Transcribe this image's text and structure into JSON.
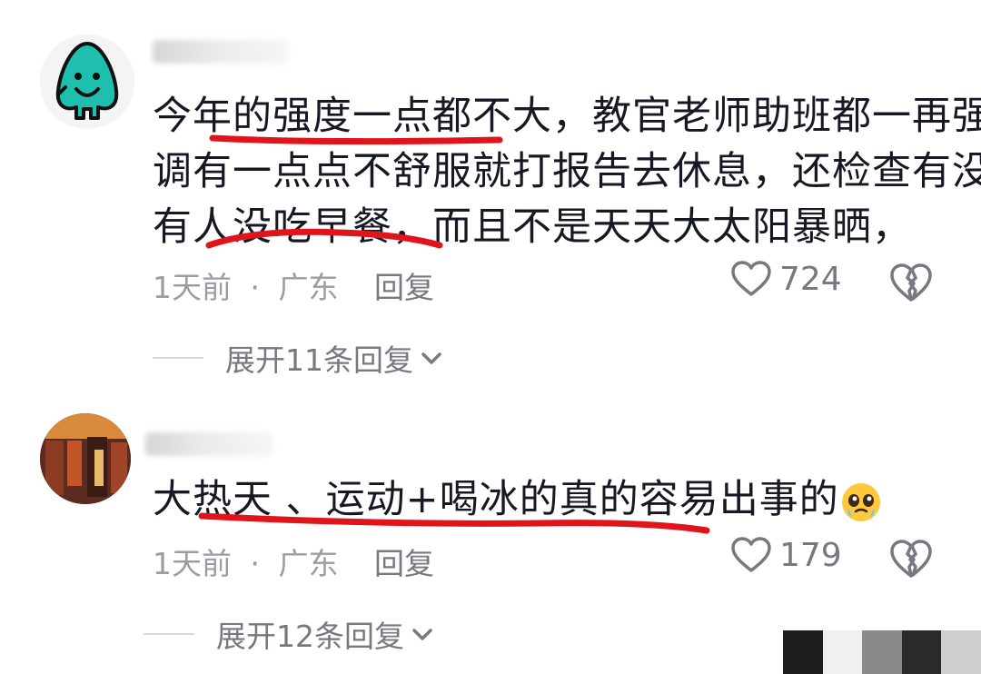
{
  "comments": [
    {
      "text_lines": [
        "今年的强度一点都不大，教官老师助班都一再强",
        "调有一点点不舒服就打报告去休息，还检查有没",
        "有人没吃早餐，而且不是天天大太阳暴晒，"
      ],
      "time": "1天前",
      "separator": "·",
      "location": "广东",
      "reply_label": "回复",
      "like_count": "724",
      "expand_label": "展开11条回复"
    },
    {
      "text_lines": [
        "大热天 、运动+喝冰的真的容易出事的"
      ],
      "time": "1天前",
      "separator": "·",
      "location": "广东",
      "reply_label": "回复",
      "like_count": "179",
      "expand_label": "展开12条回复"
    }
  ],
  "colors": {
    "text": "#161823",
    "meta": "#9c9da2",
    "action": "#777880",
    "annotation_red": "#e0151c",
    "avatar1_accent": "#1fbfae"
  },
  "icons": {
    "like": "heart-outline-icon",
    "dislike": "broken-heart-icon",
    "expand": "chevron-down-icon",
    "emoji": "pleading-face-emoji"
  }
}
